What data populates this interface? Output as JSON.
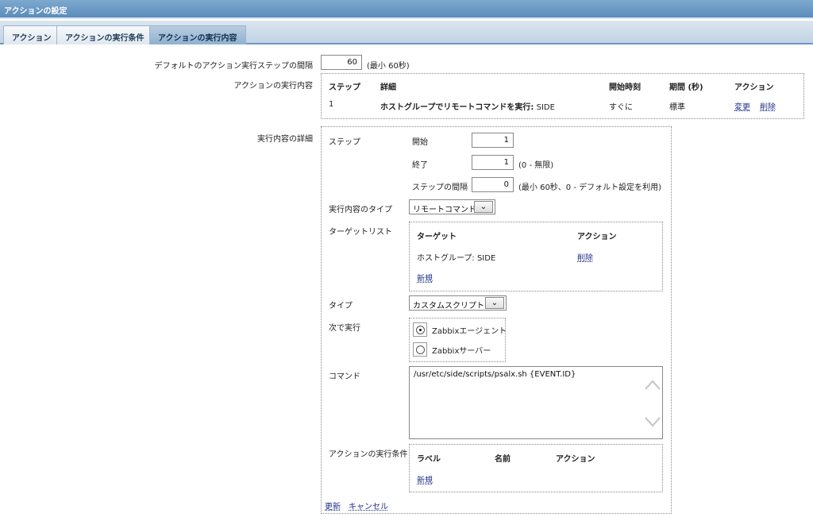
{
  "window": {
    "title": "アクションの設定"
  },
  "tabs": [
    {
      "label": "アクション"
    },
    {
      "label": "アクションの実行条件"
    },
    {
      "label": "アクションの実行内容"
    }
  ],
  "default_step": {
    "label": "デフォルトのアクション実行ステップの間隔",
    "value": "60",
    "hint": "(最小 60秒)"
  },
  "operations": {
    "label": "アクションの実行内容",
    "headers": {
      "step": "ステップ",
      "detail": "詳細",
      "start": "開始時刻",
      "period": "期間 (秒)",
      "action": "アクション"
    },
    "rows": [
      {
        "step": "1",
        "detail_bold": "ホストグループでリモートコマンドを実行:",
        "detail_rest": "SIDE",
        "start": "すぐに",
        "period": "標準",
        "edit": "変更",
        "delete": "削除"
      }
    ]
  },
  "details": {
    "label": "実行内容の詳細",
    "step": {
      "label": "ステップ",
      "from_label": "開始",
      "from_value": "1",
      "to_label": "終了",
      "to_value": "1",
      "to_hint": "(0 - 無限)",
      "period_label": "ステップの間隔",
      "period_value": "0",
      "period_hint": "(最小 60秒、0 - デフォルト設定を利用)"
    },
    "op_type": {
      "label": "実行内容のタイプ",
      "value": "リモートコマンド"
    },
    "target_list": {
      "label": "ターゲットリスト",
      "header_target": "ターゲット",
      "header_action": "アクション",
      "rows": [
        {
          "target": "ホストグループ: SIDE",
          "delete": "削除"
        }
      ],
      "new": "新規"
    },
    "type": {
      "label": "タイプ",
      "value": "カスタムスクリプト"
    },
    "execute_on": {
      "label": "次で実行",
      "options": [
        {
          "label": "Zabbixエージェント",
          "selected": true
        },
        {
          "label": "Zabbixサーバー",
          "selected": false
        }
      ]
    },
    "command": {
      "label": "コマンド",
      "value": "/usr/etc/side/scripts/psalx.sh {EVENT.ID}"
    },
    "conditions": {
      "label": "アクションの実行条件",
      "header_label": "ラベル",
      "header_name": "名前",
      "header_action": "アクション",
      "new": "新規"
    },
    "update": "更新",
    "cancel": "キャンセル"
  }
}
